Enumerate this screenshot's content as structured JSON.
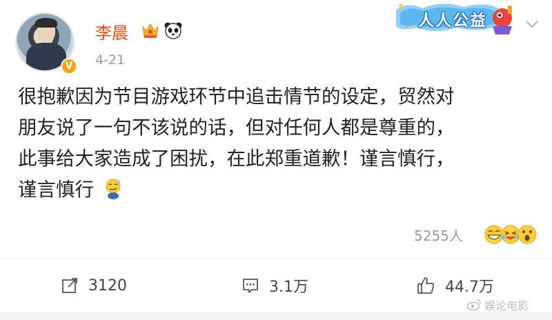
{
  "post": {
    "author": "李晨",
    "date": "4-21",
    "banner_label": "人人公益",
    "text_lines": [
      "很抱歉因为节目游戏环节中追击情节的设定，贸然对",
      "朋友说了一句不该说的话，但对任何人都是尊重的，",
      "此事给大家造成了困扰，在此郑重道歉！谨言慎行，",
      "谨言慎行"
    ],
    "verified_mark": "V",
    "reaction_count": "5255人",
    "actions": {
      "repost": "3120",
      "comment": "3.1万",
      "like": "44.7万"
    },
    "watermark": "娱论电影"
  },
  "icons": {
    "avatar": "avatar-photo",
    "verified": "verified-badge-icon",
    "crown": "crown-member-icon",
    "panda": "panda-icon",
    "banner": "public-welfare-banner-icon",
    "chevron": "chevron-down-icon",
    "inline_emoji": "awkward-emoji-icon",
    "reactions": [
      "grin-emoji-icon",
      "laugh-cry-emoji-icon",
      "surprised-emoji-icon"
    ],
    "repost": "repost-icon",
    "comment": "comment-icon",
    "like": "thumbs-up-icon",
    "weibo": "weibo-logo-icon"
  },
  "colors": {
    "author": "#f04a14",
    "meta": "#9a9a9a",
    "verified": "#f7a21b",
    "banner": "#1f6fd0"
  }
}
